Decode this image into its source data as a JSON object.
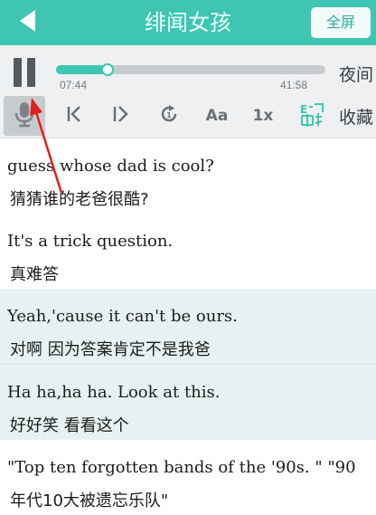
{
  "header": {
    "title": "绯闻女孩",
    "fullscreen_label": "全屏",
    "back_icon": "back-arrow-icon",
    "color": "#3fc6b3"
  },
  "player": {
    "current_time": "07:44",
    "total_time": "41:58",
    "progress_fraction": 0.19,
    "night_label": "夜间",
    "favorite_label": "收藏",
    "speed_label": "1x",
    "font_label": "Aa",
    "icons": [
      "pause-icon",
      "microphone-icon",
      "previous-sentence-icon",
      "next-sentence-icon",
      "repeat-icon",
      "font-size-icon",
      "speed-icon",
      "translate-icon"
    ]
  },
  "subtitles": [
    {
      "en": "guess whose dad is cool?",
      "zh": "猜猜谁的老爸很酷?",
      "highlighted": false
    },
    {
      "en": "It's a trick question.",
      "zh": "真难答",
      "highlighted": false
    },
    {
      "en": "Yeah,'cause it can't be ours.",
      "zh": "对啊 因为答案肯定不是我爸",
      "highlighted": true
    },
    {
      "en": "Ha ha,ha ha. Look at this.",
      "zh": "好好笑 看看这个",
      "highlighted": true
    },
    {
      "en": "\"Top ten forgotten bands of the '90s. \" \"90",
      "zh": "年代10大被遗忘乐队\"",
      "highlighted": false
    }
  ],
  "annotation_color": "#e02020"
}
